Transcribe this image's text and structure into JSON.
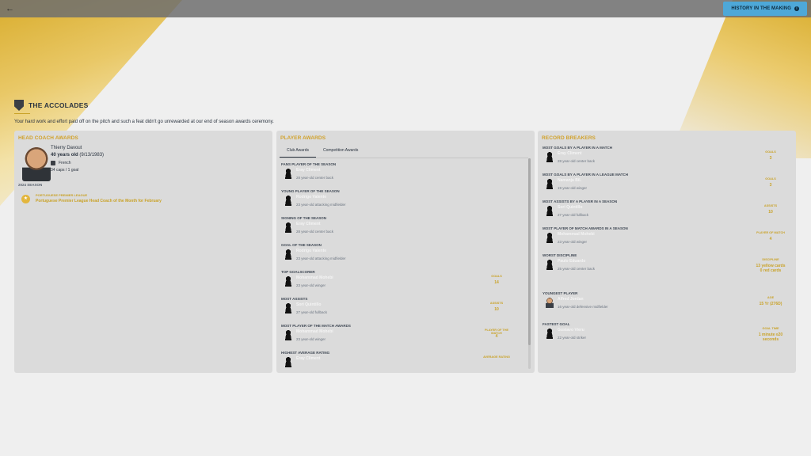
{
  "topbar": {
    "back_icon": "back-arrow-icon",
    "history_label": "HISTORY IN THE MAKING",
    "history_icon": "info-icon"
  },
  "header": {
    "icon": "shield-icon",
    "title": "THE ACCOLADES",
    "intro": "Your hard work and effort paid off on the pitch and such a feat didn't go unrewarded at our end of season awards ceremony."
  },
  "coach": {
    "panel_title": "HEAD COACH AWARDS",
    "name": "Thierry Davout",
    "age_bold": "40 years old",
    "age_rest": " (9/13/1983)",
    "nation": "French",
    "caps": "34 caps / 1 goal",
    "season": "2024 SEASON",
    "award_league": "PORTUGUESE PREMIER LEAGUE",
    "award_name": "Portuguese Premier League Head Coach of the Month for February"
  },
  "player_awards": {
    "panel_title": "PLAYER AWARDS",
    "tabs": [
      "Club Awards",
      "Competition Awards"
    ],
    "rows": [
      {
        "label": "FANS PLAYER OF THE SEASON",
        "name": "Eray Climent",
        "desc": "28 year-old center back",
        "stat_label": "",
        "stat_value": ""
      },
      {
        "label": "YOUNG PLAYER OF THE SEASON",
        "name": "Rodrigo Valente",
        "desc": "23 year-old attacking midfielder",
        "stat_label": "",
        "stat_value": ""
      },
      {
        "label": "SIGNING OF THE SEASON",
        "name": "Eray Climent",
        "desc": "28 year-old center back",
        "stat_label": "",
        "stat_value": ""
      },
      {
        "label": "GOAL OF THE SEASON",
        "name": "Rodrigo Valente",
        "desc": "23 year-old attacking midfielder",
        "stat_label": "",
        "stat_value": ""
      },
      {
        "label": "TOP GOALSCORER",
        "name": "Mohammad Mohebi",
        "desc": "23 year-old winger",
        "stat_label": "GOALS",
        "stat_value": "14"
      },
      {
        "label": "MOST ASSISTS",
        "name": "Sori Quintillo",
        "desc": "27 year-old fullback",
        "stat_label": "ASSISTS",
        "stat_value": "10"
      },
      {
        "label": "MOST PLAYER OF THE MATCH AWARDS",
        "name": "Mohammad Mohebi",
        "desc": "23 year-old winger",
        "stat_label": "PLAYER OF THE MATCH",
        "stat_value": "4"
      },
      {
        "label": "HIGHEST AVERAGE RATING",
        "name": "Eray Climent",
        "desc": "",
        "stat_label": "AVERAGE RATING",
        "stat_value": ""
      }
    ]
  },
  "records": {
    "panel_title": "RECORD BREAKERS",
    "rows": [
      {
        "label": "MOST GOALS BY A PLAYER IN A MATCH",
        "name": "Eray Climent",
        "desc": "28 year-old center back",
        "stat_label": "GOALS",
        "stat_value": "3"
      },
      {
        "label": "MOST GOALS BY A PLAYER IN A LEAGUE MATCH",
        "name": "Namanja Bil.",
        "desc": "19 year-old winger",
        "stat_label": "GOALS",
        "stat_value": "3"
      },
      {
        "label": "MOST ASSISTS BY A PLAYER IN A SEASON",
        "name": "Sori Quintillo",
        "desc": "27 year-old fullback",
        "stat_label": "ASSISTS",
        "stat_value": "10"
      },
      {
        "label": "MOST PLAYER OF MATCH AWARDS IN A SEASON",
        "name": "Mohammad Mohebi",
        "desc": "23 year-old winger",
        "stat_label": "PLAYER OF MATCH",
        "stat_value": "4"
      },
      {
        "label": "WORST DISCIPLINE",
        "name": "Paulo Eduardo",
        "desc": "25 year-old center back",
        "stat_label": "DISCIPLINE",
        "stat_value": "13 yellow cards 0 red cards"
      },
      {
        "label": "YOUNGEST PLAYER",
        "name": "Alfred Jordan",
        "desc": "16 year-old defensive midfielder",
        "stat_label": "AGE",
        "stat_value": "15 Yr (276D)"
      },
      {
        "label": "FASTEST GOAL",
        "name": "Gustavo Vieru",
        "desc": "22 year-old striker",
        "stat_label": "GOAL TIME",
        "stat_value": "1 minute ≤20 seconds"
      }
    ]
  }
}
